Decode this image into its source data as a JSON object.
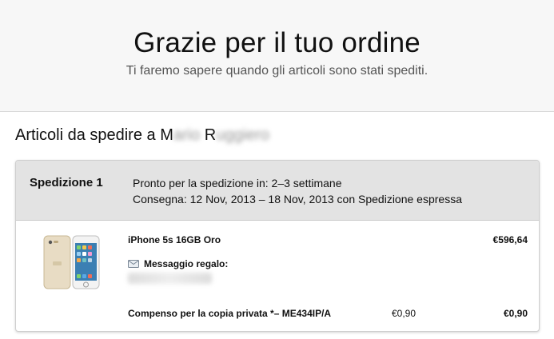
{
  "header": {
    "title": "Grazie per il tuo ordine",
    "subtitle": "Ti faremo sapere quando gli articoli sono stati spediti."
  },
  "recipient": {
    "prefix": "Articoli da spedire a M",
    "first_name_redacted": "ario",
    "middle": " R",
    "last_name_redacted": "uggiero"
  },
  "shipment": {
    "title": "Spedizione 1",
    "ready_line": "Pronto per la spedizione in: 2–3 settimane",
    "delivery_line": "Consegna: 12 Nov, 2013 – 18 Nov, 2013 con Spedizione espressa"
  },
  "item": {
    "name": "iPhone 5s 16GB Oro",
    "price": "€596,64",
    "gift_label": "Messaggio regalo:",
    "image_icon": "iphone-product-icon"
  },
  "fee": {
    "name": "Compenso per la copia privata *– ME434IP/A",
    "unit_price": "€0,90",
    "total": "€0,90"
  },
  "colors": {
    "hero_bg": "#f7f7f7",
    "shipment_header_bg": "#e3e3e3",
    "text": "#111111",
    "subtitle_text": "#555555"
  }
}
